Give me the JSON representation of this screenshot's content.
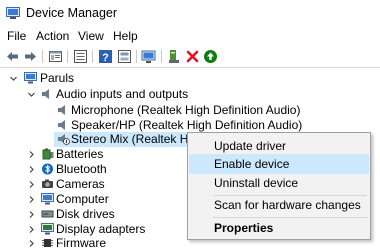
{
  "window": {
    "title": "Device Manager"
  },
  "menu": {
    "file": "File",
    "action": "Action",
    "view": "View",
    "help": "Help"
  },
  "toolbar": {
    "icons": [
      "back-icon",
      "forward-icon",
      "properties-icon",
      "show-hidden-icon",
      "help-icon",
      "scan-icon",
      "monitor-icon",
      "update-driver-icon",
      "uninstall-icon",
      "enable-icon"
    ]
  },
  "tree": {
    "root": "Paruls",
    "audio": "Audio inputs and outputs",
    "microphone": "Microphone (Realtek High Definition Audio)",
    "speaker": "Speaker/HP (Realtek High Definition Audio)",
    "stereo_mix": "Stereo Mix (Realtek High D",
    "batteries": "Batteries",
    "bluetooth": "Bluetooth",
    "cameras": "Cameras",
    "computer": "Computer",
    "disk_drives": "Disk drives",
    "display_adapters": "Display adapters",
    "firmware": "Firmware"
  },
  "context_menu": {
    "update_driver": "Update driver",
    "enable_device": "Enable device",
    "uninstall_device": "Uninstall device",
    "scan": "Scan for hardware changes",
    "properties": "Properties"
  },
  "colors": {
    "selection": "#cce8ff",
    "delete_red": "#e81123",
    "enable_green": "#107c10",
    "title_icon": "#3a7bd5"
  }
}
